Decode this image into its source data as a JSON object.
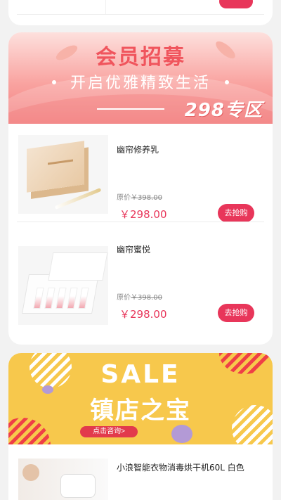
{
  "member_banner": {
    "title": "会员招募",
    "subtitle": "开启优雅精致生活",
    "zone": "298专区"
  },
  "products": [
    {
      "name": "幽帘修养乳",
      "orig_label": "原价",
      "orig_price": "￥398.00",
      "price": "￥298.00",
      "buy_label": "去抢购"
    },
    {
      "name": "幽帘蜜悦",
      "orig_label": "原价",
      "orig_price": "￥398.00",
      "price": "￥298.00",
      "buy_label": "去抢购"
    }
  ],
  "sale_banner": {
    "headline": "SALE",
    "title": "镇店之宝",
    "consult_label": "点击咨询>"
  },
  "featured_product": {
    "name": "小浪智能衣物消毒烘干机60L 白色"
  },
  "colors": {
    "accent": "#e8365a",
    "sale_bg": "#f7c84c",
    "member_pink": "#f37f7f"
  }
}
